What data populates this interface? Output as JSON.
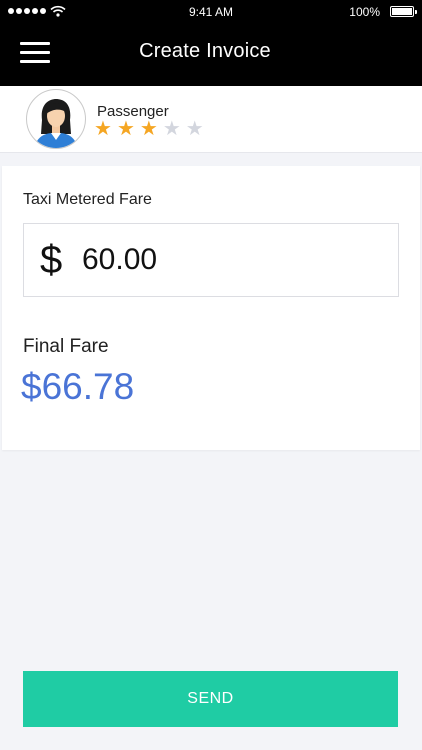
{
  "status_bar": {
    "time": "9:41 AM",
    "battery": "100%"
  },
  "nav": {
    "title": "Create Invoice",
    "menu_icon": "hamburger-menu-icon"
  },
  "passenger": {
    "label": "Passenger",
    "rating": 3,
    "rating_max": 5,
    "avatar_icon": "female-avatar-icon"
  },
  "fare": {
    "label": "Taxi Metered Fare",
    "currency_symbol": "$",
    "value": "60.00"
  },
  "final": {
    "label": "Final Fare",
    "value": "$66.78"
  },
  "actions": {
    "send_label": "SEND"
  },
  "colors": {
    "accent_blue": "#4a74d6",
    "send_green": "#1fcca4",
    "star_on": "#f5a623",
    "star_off": "#d3d6de"
  }
}
